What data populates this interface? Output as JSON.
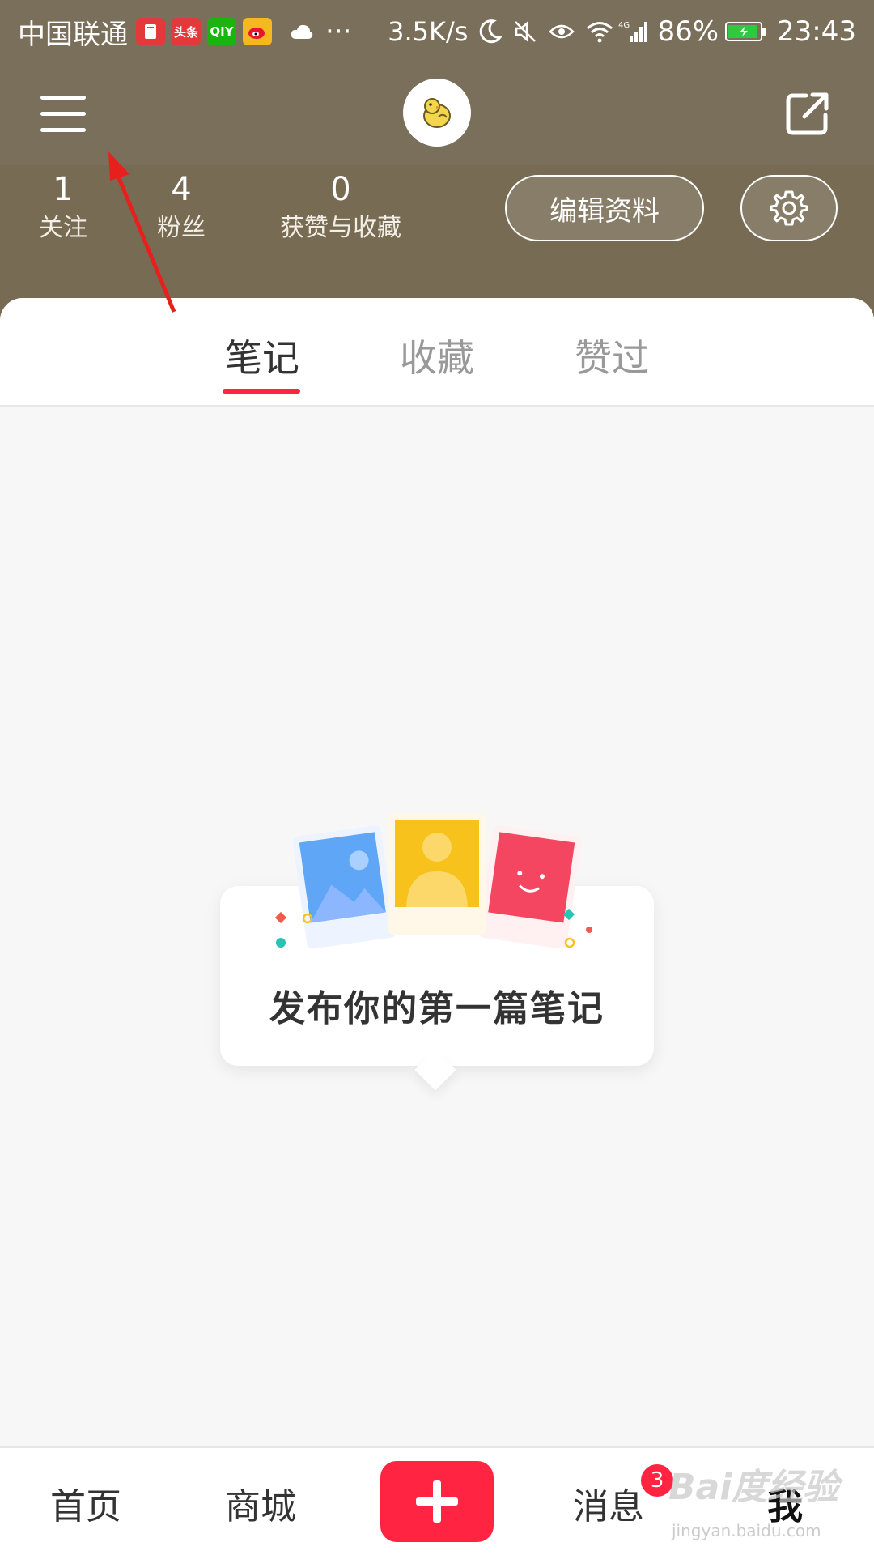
{
  "status_bar": {
    "carrier": "中国联通",
    "app_badges": [
      {
        "name": "book-app-icon",
        "text": "",
        "color": "#e23a3a"
      },
      {
        "name": "toutiao-app-icon",
        "text": "头条",
        "color": "#e23a3a"
      },
      {
        "name": "iqiyi-app-icon",
        "text": "QIY",
        "color": "#19b50e"
      },
      {
        "name": "weibo-app-icon",
        "text": "",
        "color": "#f5b920"
      }
    ],
    "more": "···",
    "speed": "3.5K/s",
    "network": "4G",
    "battery_percent": "86%",
    "battery_level": 0.86,
    "time": "23:43"
  },
  "header": {
    "menu_icon": "hamburger-menu-icon",
    "avatar_icon": "chick-avatar-icon",
    "share_icon": "share-external-icon"
  },
  "profile": {
    "stats": [
      {
        "value": "1",
        "label": "关注"
      },
      {
        "value": "4",
        "label": "粉丝"
      },
      {
        "value": "0",
        "label": "获赞与收藏"
      }
    ],
    "edit_button": "编辑资料",
    "settings_icon": "gear-icon"
  },
  "tabs": {
    "items": [
      "笔记",
      "收藏",
      "赞过"
    ],
    "active": "笔记"
  },
  "empty_state": {
    "text": "发布你的第一篇笔记"
  },
  "bottom_nav": {
    "home": "首页",
    "mall": "商城",
    "publish_icon": "plus-icon",
    "messages": "消息",
    "messages_badge": "3",
    "me": "我"
  },
  "watermark": {
    "text": "Bai度经验",
    "sub": "jingyan.baidu.com"
  },
  "colors": {
    "header_bg": "#7a6f5a",
    "accent": "#ff2442",
    "annotation_arrow": "#e8201d"
  }
}
